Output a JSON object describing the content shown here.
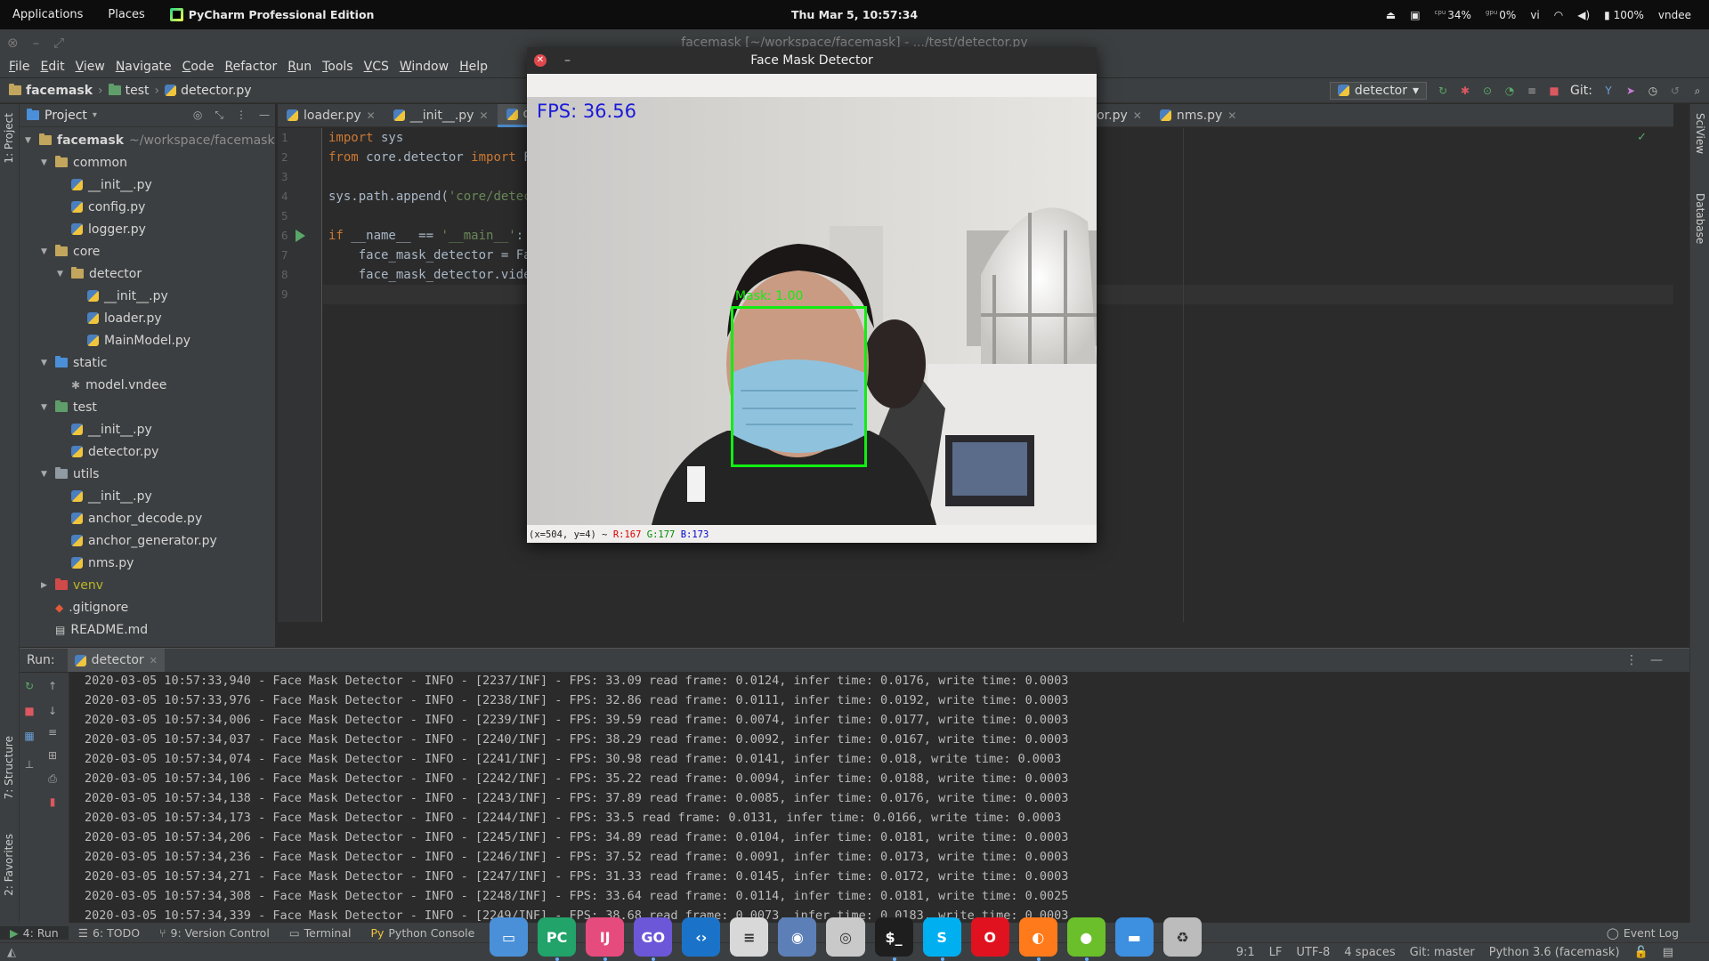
{
  "topbar": {
    "applications": "Applications",
    "places": "Places",
    "app_name": "PyCharm Professional Edition",
    "clock": "Thu Mar  5, 10:57:34",
    "cpu_label": "cpu",
    "cpu": "34%",
    "gpu_label": "gpu",
    "gpu": "0%",
    "lang": "vi",
    "battery": "100%",
    "user": "vndee"
  },
  "ide": {
    "window_title": "facemask [~/workspace/facemask] - .../test/detector.py",
    "menu": [
      "File",
      "Edit",
      "View",
      "Navigate",
      "Code",
      "Refactor",
      "Run",
      "Tools",
      "VCS",
      "Window",
      "Help"
    ],
    "breadcrumb": [
      "facemask",
      "test",
      "detector.py"
    ],
    "run_config": "detector",
    "git_label": "Git:"
  },
  "project_panel": {
    "title": "Project",
    "side_label": "1: Project",
    "tree": [
      {
        "label": "facemask",
        "extra": "~/workspace/facemask",
        "depth": 0,
        "kind": "folder",
        "open": true
      },
      {
        "label": "common",
        "depth": 1,
        "kind": "folder",
        "open": true
      },
      {
        "label": "__init__.py",
        "depth": 2,
        "kind": "py"
      },
      {
        "label": "config.py",
        "depth": 2,
        "kind": "py"
      },
      {
        "label": "logger.py",
        "depth": 2,
        "kind": "py"
      },
      {
        "label": "core",
        "depth": 1,
        "kind": "folder",
        "open": true
      },
      {
        "label": "detector",
        "depth": 2,
        "kind": "folder",
        "open": true
      },
      {
        "label": "__init__.py",
        "depth": 3,
        "kind": "py"
      },
      {
        "label": "loader.py",
        "depth": 3,
        "kind": "py"
      },
      {
        "label": "MainModel.py",
        "depth": 3,
        "kind": "py"
      },
      {
        "label": "static",
        "depth": 1,
        "kind": "folder-blue",
        "open": true
      },
      {
        "label": "model.vndee",
        "depth": 2,
        "kind": "file"
      },
      {
        "label": "test",
        "depth": 1,
        "kind": "folder-green",
        "open": true
      },
      {
        "label": "__init__.py",
        "depth": 2,
        "kind": "py"
      },
      {
        "label": "detector.py",
        "depth": 2,
        "kind": "py"
      },
      {
        "label": "utils",
        "depth": 1,
        "kind": "folder-gray",
        "open": true
      },
      {
        "label": "__init__.py",
        "depth": 2,
        "kind": "py"
      },
      {
        "label": "anchor_decode.py",
        "depth": 2,
        "kind": "py"
      },
      {
        "label": "anchor_generator.py",
        "depth": 2,
        "kind": "py"
      },
      {
        "label": "nms.py",
        "depth": 2,
        "kind": "py"
      },
      {
        "label": "venv",
        "depth": 1,
        "kind": "folder-red",
        "open": false
      },
      {
        "label": ".gitignore",
        "depth": 1,
        "kind": "git"
      },
      {
        "label": "README.md",
        "depth": 1,
        "kind": "md"
      }
    ]
  },
  "editor": {
    "tabs": [
      {
        "label": "loader.py"
      },
      {
        "label": "__init__.py"
      },
      {
        "label": "det",
        "active": true
      },
      {
        "label": "nchor_generator.py"
      },
      {
        "label": "nms.py"
      }
    ],
    "line_numbers": [
      "1",
      "2",
      "3",
      "4",
      "5",
      "6",
      "7",
      "8",
      "9"
    ],
    "code": [
      [
        {
          "t": "import",
          "c": "kw"
        },
        {
          "t": " sys",
          "c": ""
        }
      ],
      [
        {
          "t": "from",
          "c": "kw"
        },
        {
          "t": " core.detector ",
          "c": ""
        },
        {
          "t": "import",
          "c": "kw"
        },
        {
          "t": " Fa",
          "c": ""
        }
      ],
      [
        {
          "t": "",
          "c": ""
        }
      ],
      [
        {
          "t": "sys.path.",
          "c": ""
        },
        {
          "t": "append",
          "c": ""
        },
        {
          "t": "(",
          "c": ""
        },
        {
          "t": "'core/detect",
          "c": "str"
        }
      ],
      [
        {
          "t": "",
          "c": ""
        }
      ],
      [
        {
          "t": "if",
          "c": "kw"
        },
        {
          "t": " __name__ == ",
          "c": ""
        },
        {
          "t": "'__main__'",
          "c": "str"
        },
        {
          "t": ":",
          "c": ""
        }
      ],
      [
        {
          "t": "    face_mask_detector = ",
          "c": ""
        },
        {
          "t": "Fac",
          "c": ""
        }
      ],
      [
        {
          "t": "    face_mask_detector.",
          "c": ""
        },
        {
          "t": "video",
          "c": ""
        }
      ],
      [
        {
          "t": "",
          "c": ""
        }
      ]
    ]
  },
  "cv_window": {
    "title": "Face Mask Detector",
    "fps_overlay": "FPS: 36.56",
    "detection_label": "Mask: 1.00",
    "status_coords": "(x=504, y=4) ~ ",
    "status_r": "R:167",
    "status_g": "G:177",
    "status_b": "B:173"
  },
  "run_panel": {
    "label": "Run:",
    "tab": "detector",
    "log": [
      "2020-03-05 10:57:33,940 - Face Mask Detector - INFO - [2237/INF] - FPS: 33.09 read frame: 0.0124, infer time: 0.0176, write time: 0.0003",
      "2020-03-05 10:57:33,976 - Face Mask Detector - INFO - [2238/INF] - FPS: 32.86 read frame: 0.0111, infer time: 0.0192, write time: 0.0003",
      "2020-03-05 10:57:34,006 - Face Mask Detector - INFO - [2239/INF] - FPS: 39.59 read frame: 0.0074, infer time: 0.0177, write time: 0.0003",
      "2020-03-05 10:57:34,037 - Face Mask Detector - INFO - [2240/INF] - FPS: 38.29 read frame: 0.0092, infer time: 0.0167, write time: 0.0003",
      "2020-03-05 10:57:34,074 - Face Mask Detector - INFO - [2241/INF] - FPS: 30.98 read frame: 0.0141, infer time: 0.018, write time: 0.0003",
      "2020-03-05 10:57:34,106 - Face Mask Detector - INFO - [2242/INF] - FPS: 35.22 read frame: 0.0094, infer time: 0.0188, write time: 0.0003",
      "2020-03-05 10:57:34,138 - Face Mask Detector - INFO - [2243/INF] - FPS: 37.89 read frame: 0.0085, infer time: 0.0176, write time: 0.0003",
      "2020-03-05 10:57:34,173 - Face Mask Detector - INFO - [2244/INF] - FPS: 33.5 read frame: 0.0131, infer time: 0.0166, write time: 0.0003",
      "2020-03-05 10:57:34,206 - Face Mask Detector - INFO - [2245/INF] - FPS: 34.89 read frame: 0.0104, infer time: 0.0181, write time: 0.0003",
      "2020-03-05 10:57:34,236 - Face Mask Detector - INFO - [2246/INF] - FPS: 37.52 read frame: 0.0091, infer time: 0.0173, write time: 0.0003",
      "2020-03-05 10:57:34,271 - Face Mask Detector - INFO - [2247/INF] - FPS: 31.33 read frame: 0.0145, infer time: 0.0172, write time: 0.0003",
      "2020-03-05 10:57:34,308 - Face Mask Detector - INFO - [2248/INF] - FPS: 33.64 read frame: 0.0114, infer time: 0.0181, write time: 0.0025",
      "2020-03-05 10:57:34,339 - Face Mask Detector - INFO - [2249/INF] - FPS: 38.68 read frame: 0.0073, infer time: 0.0183, write time: 0.0003"
    ]
  },
  "side_labels": {
    "structure": "7: Structure",
    "favorites": "2: Favorites",
    "sciview": "SciView",
    "database": "Database"
  },
  "bottom_tools": {
    "run": "4: Run",
    "todo": "6: TODO",
    "vcs": "9: Version Control",
    "terminal": "Terminal",
    "python_console": "Python Console",
    "event_log": "Event Log"
  },
  "status": {
    "position": "9:1",
    "line_sep": "LF",
    "encoding": "UTF-8",
    "indent": "4 spaces",
    "git": "Git: master",
    "interpreter": "Python 3.6 (facemask)"
  },
  "dock": [
    {
      "name": "files-icon",
      "color": "#4a90d9",
      "glyph": "▭"
    },
    {
      "name": "pycharm-icon",
      "color": "#21a36a",
      "glyph": "PC"
    },
    {
      "name": "intellij-icon",
      "color": "#e64b7d",
      "glyph": "IJ"
    },
    {
      "name": "goland-icon",
      "color": "#6b57d8",
      "glyph": "GO"
    },
    {
      "name": "vscode-icon",
      "color": "#1a73c8",
      "glyph": "‹›"
    },
    {
      "name": "text-editor-icon",
      "color": "#d8d8d8",
      "glyph": "≡"
    },
    {
      "name": "chat-icon",
      "color": "#5c7fb8",
      "glyph": "◉"
    },
    {
      "name": "speaker-icon",
      "color": "#c9c9c9",
      "glyph": "◎"
    },
    {
      "name": "terminal-icon",
      "color": "#1e1e1e",
      "glyph": "$_"
    },
    {
      "name": "skype-icon",
      "color": "#00aff0",
      "glyph": "S"
    },
    {
      "name": "opera-icon",
      "color": "#e0121f",
      "glyph": "O"
    },
    {
      "name": "firefox-icon",
      "color": "#ff7a1a",
      "glyph": "◐"
    },
    {
      "name": "green-orb-icon",
      "color": "#6abf2a",
      "glyph": "●"
    },
    {
      "name": "window-icon",
      "color": "#3d8fe0",
      "glyph": "▬"
    },
    {
      "name": "trash-icon",
      "color": "#bcbcbc",
      "glyph": "♻"
    }
  ]
}
